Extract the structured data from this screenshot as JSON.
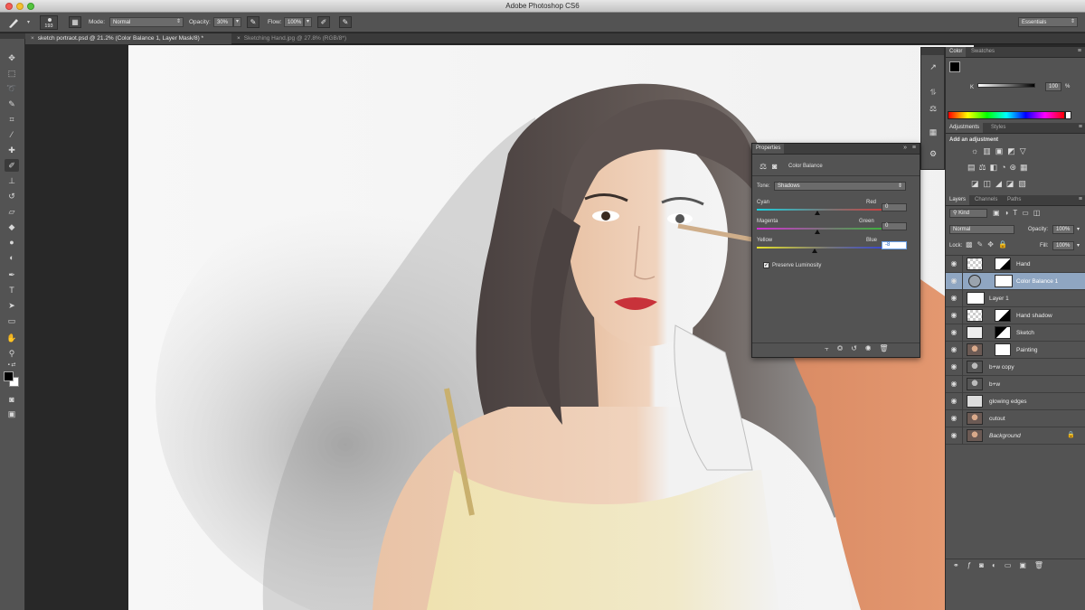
{
  "app": {
    "title": "Adobe Photoshop CS6"
  },
  "options_bar": {
    "brush_size": "193",
    "mode_label": "Mode:",
    "mode_value": "Normal",
    "opacity_label": "Opacity:",
    "opacity_value": "30%",
    "flow_label": "Flow:",
    "flow_value": "100%",
    "workspace": "Essentials"
  },
  "documents": [
    {
      "label": "sketch portraot.psd @ 21.2% (Color Balance 1, Layer Mask/8) *",
      "active": true
    },
    {
      "label": "Sketching Hand.jpg @ 27.8% (RGB/8*)",
      "active": false
    }
  ],
  "tools": [
    "move-tool",
    "marquee-tool",
    "lasso-tool",
    "quick-select-tool",
    "crop-tool",
    "eyedropper-tool",
    "healing-tool",
    "brush-tool",
    "clone-stamp-tool",
    "history-brush-tool",
    "eraser-tool",
    "gradient-tool",
    "blur-tool",
    "dodge-tool",
    "pen-tool",
    "type-tool",
    "path-select-tool",
    "shape-tool",
    "hand-tool",
    "zoom-tool"
  ],
  "color_panel": {
    "tabs": [
      "Color",
      "Swatches"
    ],
    "channel": "K",
    "value": "100",
    "unit": "%"
  },
  "adjustments_panel": {
    "tabs": [
      "Adjustments",
      "Styles"
    ],
    "heading": "Add an adjustment"
  },
  "properties_panel": {
    "tab": "Properties",
    "adjustment": "Color Balance",
    "tone_label": "Tone:",
    "tone_value": "Shadows",
    "sliders": [
      {
        "left": "Cyan",
        "right": "Red",
        "value": "0",
        "position": 0.5
      },
      {
        "left": "Magenta",
        "right": "Green",
        "value": "0",
        "position": 0.5
      },
      {
        "left": "Yellow",
        "right": "Blue",
        "value": "-8",
        "position": 0.48
      }
    ],
    "preserve_luminosity": "Preserve Luminosity",
    "preserve_checked": true
  },
  "layers_panel": {
    "tabs": [
      "Layers",
      "Channels",
      "Paths"
    ],
    "filter": "Kind",
    "blend_mode": "Normal",
    "opacity_label": "Opacity:",
    "opacity_value": "100%",
    "lock_label": "Lock:",
    "fill_label": "Fill:",
    "fill_value": "100%",
    "layers": [
      {
        "name": "Hand",
        "selected": false
      },
      {
        "name": "Color Balance 1",
        "selected": true
      },
      {
        "name": "Layer 1",
        "selected": false
      },
      {
        "name": "Hand shadow",
        "selected": false
      },
      {
        "name": "Sketch",
        "selected": false
      },
      {
        "name": "Painting",
        "selected": false
      },
      {
        "name": "b+w copy",
        "selected": false
      },
      {
        "name": "b+w",
        "selected": false
      },
      {
        "name": "glowing edges",
        "selected": false
      },
      {
        "name": "cutout",
        "selected": false
      },
      {
        "name": "Background",
        "selected": false
      }
    ]
  },
  "colors": {
    "accent_selection": "#8fa6c2",
    "panel_bg": "#535353",
    "workspace_bg": "#282828"
  }
}
